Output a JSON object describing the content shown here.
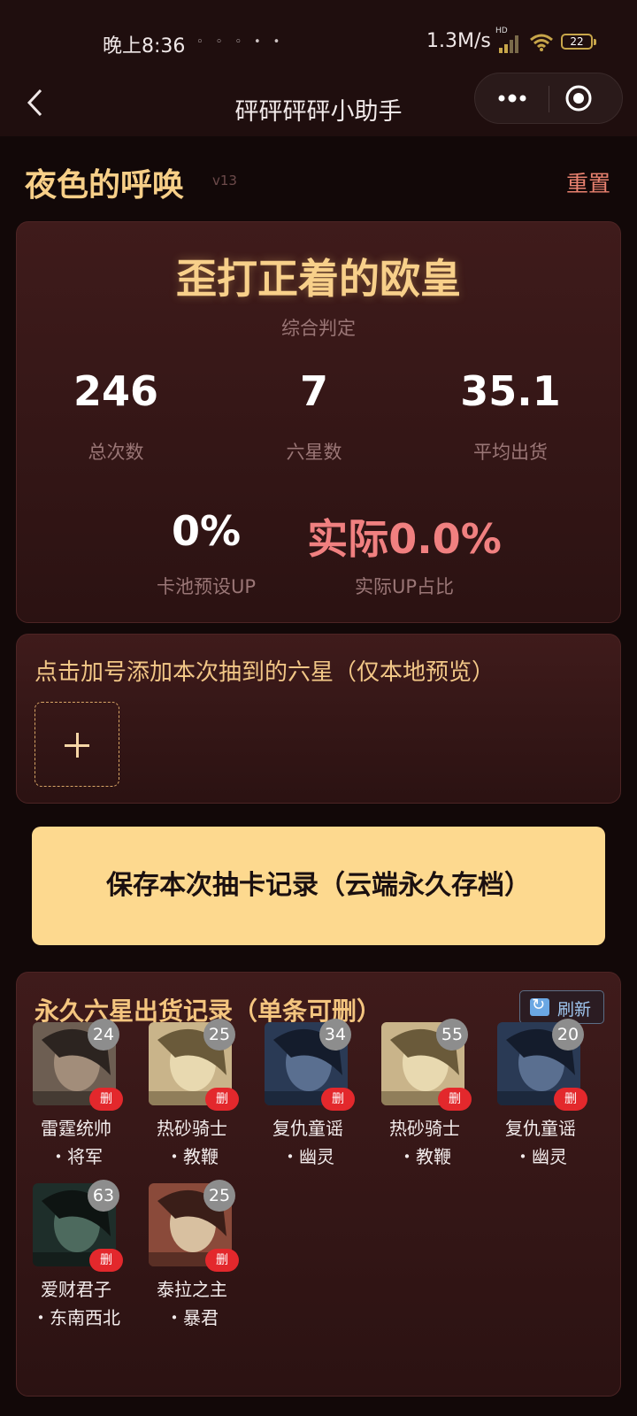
{
  "status_bar": {
    "time": "晚上8:36",
    "network_speed": "1.3M/s",
    "network_type": "HD",
    "battery": "22"
  },
  "nav": {
    "title": "砰砰砰砰小助手"
  },
  "pool": {
    "title": "夜色的呼唤",
    "version": "v13",
    "reset_label": "重置"
  },
  "summary": {
    "verdict": "歪打正着的欧皇",
    "verdict_label": "综合判定",
    "total_pulls": "246",
    "total_pulls_label": "总次数",
    "six_star_count": "7",
    "six_star_label": "六星数",
    "average": "35.1",
    "average_label": "平均出货",
    "preset_up": "0%",
    "preset_up_label": "卡池预设UP",
    "actual_up": "实际0.0%",
    "actual_up_label": "实际UP占比"
  },
  "add_section": {
    "hint": "点击加号添加本次抽到的六星（仅本地预览）"
  },
  "save_button": "保存本次抽卡记录（云端永久存档）",
  "records": {
    "title": "永久六星出货记录（单条可删）",
    "refresh_label": "刷新",
    "delete_label": "删",
    "items": [
      {
        "count": "24",
        "name": "雷霆统帅\n・将军"
      },
      {
        "count": "25",
        "name": "热砂骑士\n・教鞭"
      },
      {
        "count": "34",
        "name": "复仇童谣\n・幽灵"
      },
      {
        "count": "55",
        "name": "热砂骑士\n・教鞭"
      },
      {
        "count": "20",
        "name": "复仇童谣\n・幽灵"
      },
      {
        "count": "63",
        "name": "爱财君子\n・东南西北"
      },
      {
        "count": "25",
        "name": "泰拉之主\n・暴君"
      }
    ]
  },
  "colors": {
    "accent_gold": "#f7cf88",
    "save_button_bg": "#fdd98f",
    "delete_badge": "#e3282c",
    "reset_text": "#e98270"
  }
}
